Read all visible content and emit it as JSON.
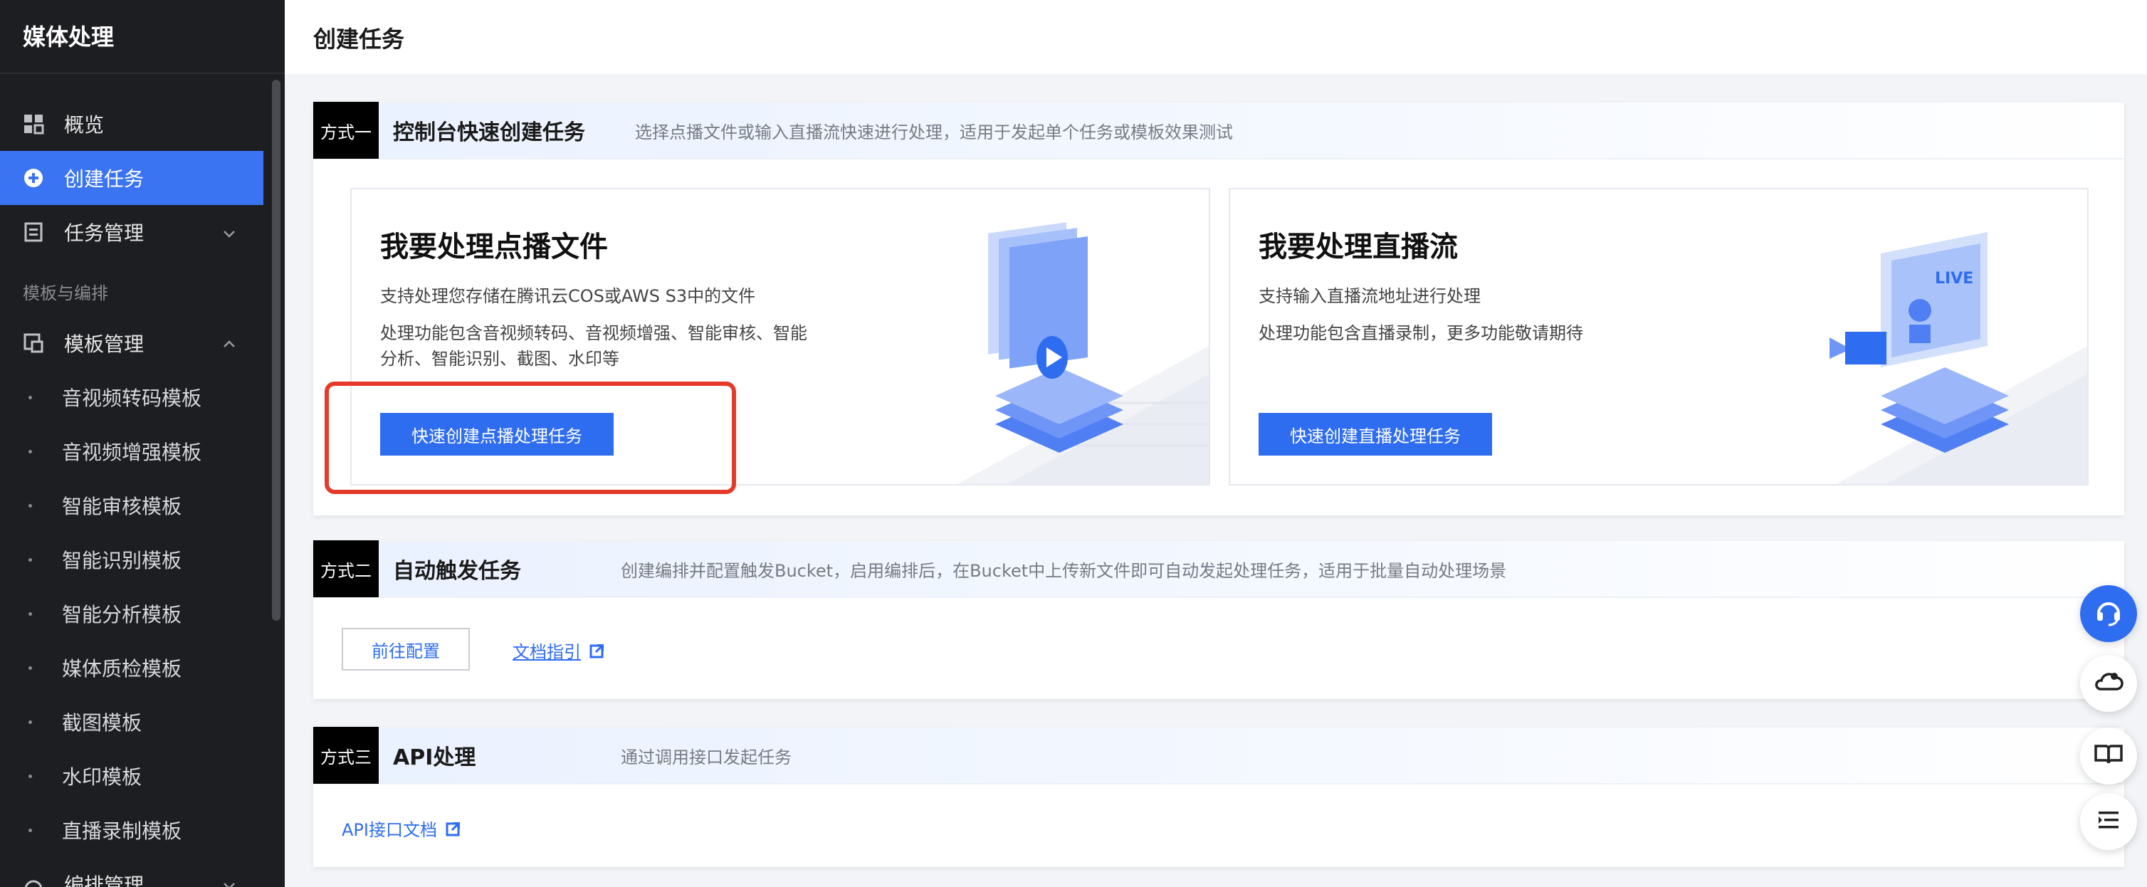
{
  "app": {
    "title": "媒体处理"
  },
  "sidebar": {
    "items": [
      {
        "label": "概览",
        "icon": "grid-icon"
      },
      {
        "label": "创建任务",
        "icon": "plus-circle-icon",
        "active": true
      },
      {
        "label": "任务管理",
        "icon": "list-doc-icon"
      }
    ],
    "group_label": "模板与编排",
    "template_menu": {
      "label": "模板管理",
      "icon": "template-icon"
    },
    "template_items": [
      "音视频转码模板",
      "音视频增强模板",
      "智能审核模板",
      "智能识别模板",
      "智能分析模板",
      "媒体质检模板",
      "截图模板",
      "水印模板",
      "直播录制模板"
    ],
    "orchestration_menu": {
      "label": "编排管理"
    }
  },
  "header": {
    "title": "创建任务"
  },
  "method1": {
    "tag": "方式一",
    "title": "控制台快速创建任务",
    "desc": "选择点播文件或输入直播流快速进行处理，适用于发起单个任务或模板效果测试",
    "vod_card": {
      "title": "我要处理点播文件",
      "line1": "支持处理您存储在腾讯云COS或AWS S3中的文件",
      "line2": "处理功能包含音视频转码、音视频增强、智能审核、智能分析、智能识别、截图、水印等",
      "button": "快速创建点播处理任务"
    },
    "live_card": {
      "title": "我要处理直播流",
      "line1": "支持输入直播流地址进行处理",
      "line2": "处理功能包含直播录制，更多功能敬请期待",
      "button": "快速创建直播处理任务",
      "art_text": "LIVE"
    }
  },
  "method2": {
    "tag": "方式二",
    "title": "自动触发任务",
    "desc": "创建编排并配置触发Bucket，启用编排后，在Bucket中上传新文件即可自动发起处理任务，适用于批量自动处理场景",
    "button": "前往配置",
    "link": "文档指引"
  },
  "method3": {
    "tag": "方式三",
    "title": "API处理",
    "desc": "通过调用接口发起任务",
    "link": "API接口文档"
  },
  "colors": {
    "accent": "#2f6df0",
    "highlight": "#e53a2a",
    "sidebar_bg": "#1d1e21"
  }
}
